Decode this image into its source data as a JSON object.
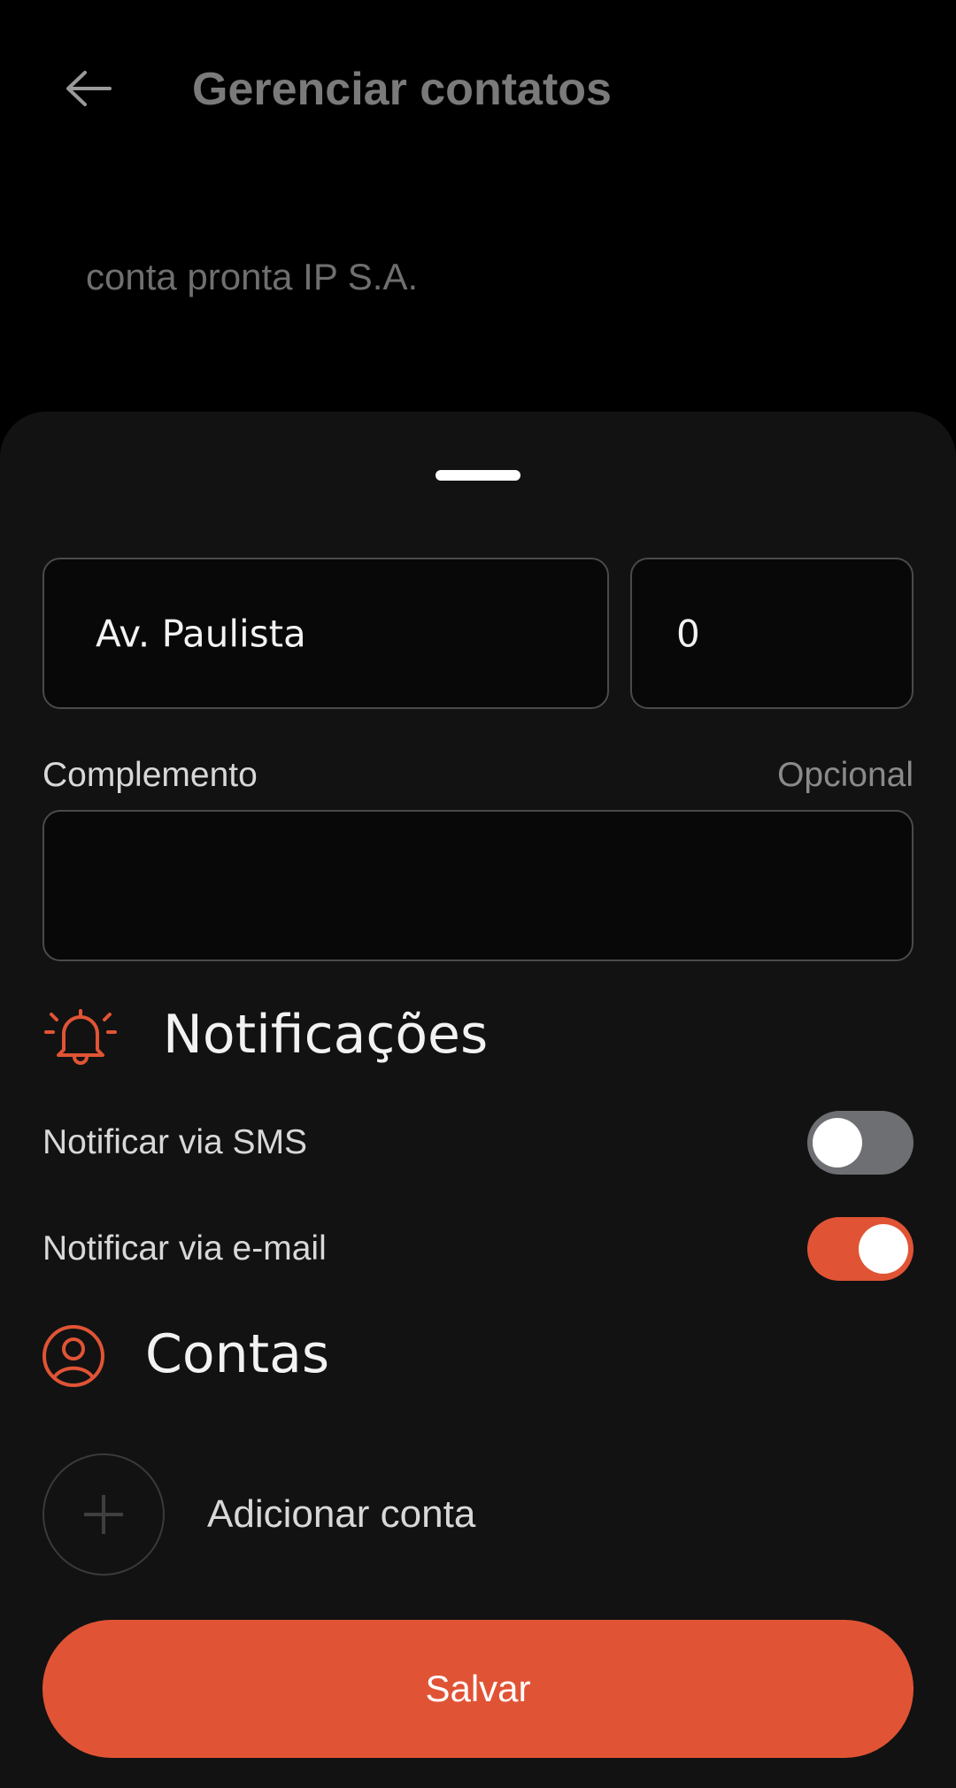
{
  "header": {
    "title": "Gerenciar contatos",
    "subtitle": "conta pronta IP S.A.",
    "back_icon": "arrow-left-icon"
  },
  "form": {
    "street": {
      "value": "Av. Paulista"
    },
    "number": {
      "value": "0"
    },
    "complement": {
      "label": "Complemento",
      "hint": "Opcional",
      "value": ""
    }
  },
  "notifications": {
    "title": "Notificações",
    "icon": "bell-icon",
    "sms": {
      "label": "Notificar via SMS",
      "enabled": false
    },
    "email": {
      "label": "Notificar via e-mail",
      "enabled": true
    }
  },
  "accounts": {
    "title": "Contas",
    "icon": "user-circle-icon",
    "add_label": "Adicionar conta"
  },
  "actions": {
    "save_label": "Salvar"
  },
  "colors": {
    "accent": "#e05435",
    "toggle_off": "#6e6f72",
    "sheet_bg": "#121212",
    "input_bg": "#080808"
  }
}
